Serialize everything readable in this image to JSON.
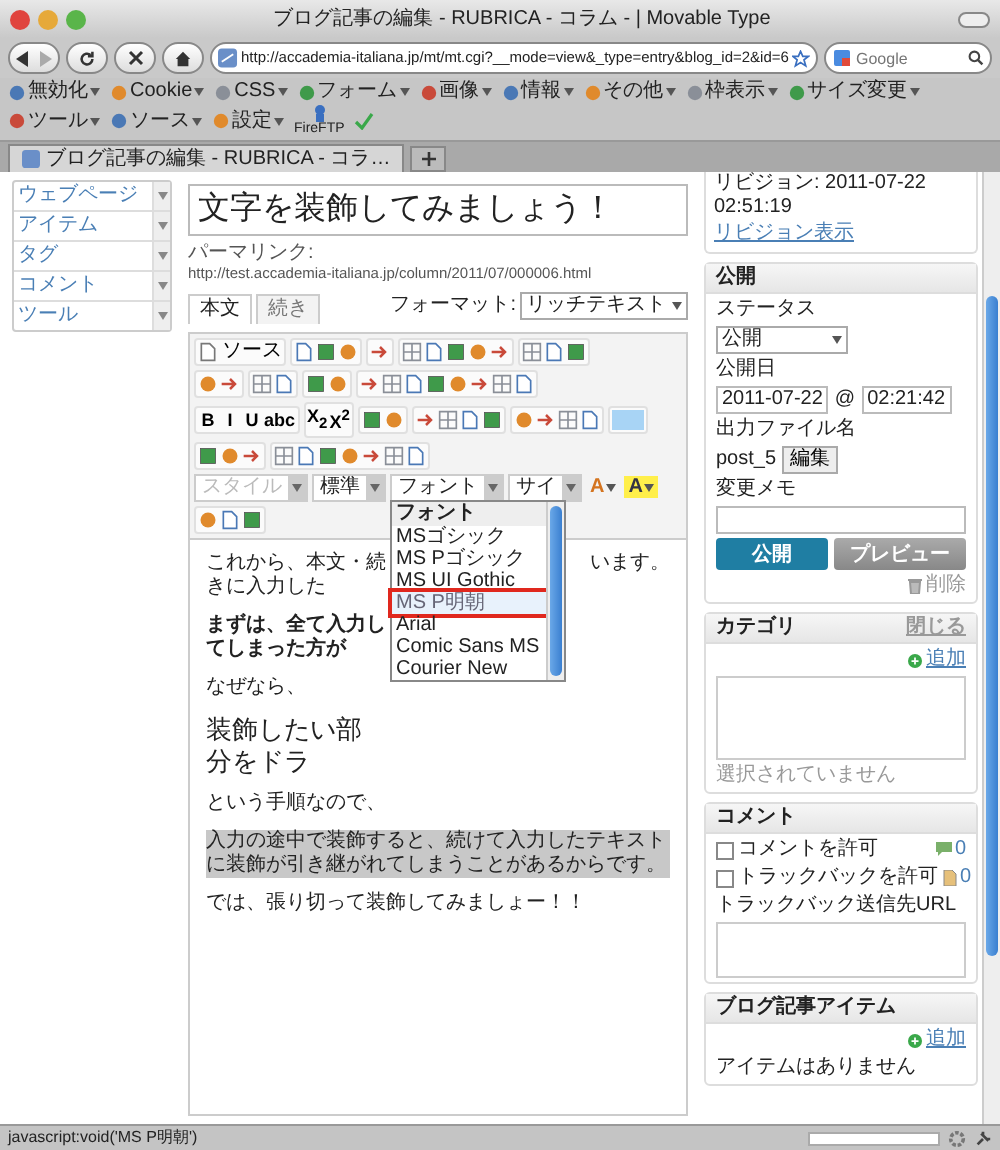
{
  "window": {
    "title": "ブログ記事の編集 - RUBRICA - コラム - | Movable Type"
  },
  "navigation": {
    "url": "http://accademia-italiana.jp/mt/mt.cgi?__mode=view&_type=entry&blog_id=2&id=6",
    "search_placeholder": "Google"
  },
  "bookmarks": [
    {
      "label": "無効化"
    },
    {
      "label": "Cookie"
    },
    {
      "label": "CSS"
    },
    {
      "label": "フォーム"
    },
    {
      "label": "画像"
    },
    {
      "label": "情報"
    },
    {
      "label": "その他"
    },
    {
      "label": "枠表示"
    },
    {
      "label": "サイズ変更"
    },
    {
      "label": "ツール"
    },
    {
      "label": "ソース"
    },
    {
      "label": "設定"
    }
  ],
  "fireftp": "FireFTP",
  "tabs": [
    {
      "title": "ブログ記事の編集 - RUBRICA - コラ…",
      "selected": true
    }
  ],
  "sidebar": {
    "items": [
      {
        "label": "ウェブページ"
      },
      {
        "label": "アイテム"
      },
      {
        "label": "タグ"
      },
      {
        "label": "コメント"
      },
      {
        "label": "ツール"
      }
    ]
  },
  "entry": {
    "title": "文字を装飾してみましょう！",
    "permalink_label": "パーマリンク:",
    "permalink": "http://test.accademia-italiana.jp/column/2011/07/000006.html",
    "editor_tabs": [
      {
        "label": "本文",
        "selected": true
      },
      {
        "label": "続き",
        "selected": false
      }
    ],
    "format_label": "フォーマット:",
    "format": "リッチテキスト",
    "toolbar_rows": [
      [
        [
          {
            "kind": "labeled",
            "label": "ソース"
          }
        ],
        [
          {
            "kind": "icon"
          },
          {
            "kind": "icon"
          },
          {
            "kind": "icon"
          }
        ],
        [
          {
            "kind": "icon"
          }
        ],
        [
          {
            "kind": "icon"
          },
          {
            "kind": "icon"
          },
          {
            "kind": "icon"
          },
          {
            "kind": "icon"
          },
          {
            "kind": "icon"
          }
        ],
        [
          {
            "kind": "icon"
          },
          {
            "kind": "icon"
          },
          {
            "kind": "icon"
          }
        ]
      ],
      [
        [
          {
            "kind": "icon"
          },
          {
            "kind": "icon"
          }
        ],
        [
          {
            "kind": "icon"
          },
          {
            "kind": "icon"
          }
        ],
        [
          {
            "kind": "icon"
          },
          {
            "kind": "icon"
          }
        ],
        [
          {
            "kind": "icon"
          },
          {
            "kind": "icon"
          },
          {
            "kind": "icon"
          },
          {
            "kind": "icon"
          },
          {
            "kind": "icon"
          },
          {
            "kind": "icon"
          },
          {
            "kind": "icon"
          },
          {
            "kind": "icon"
          }
        ]
      ],
      [
        [
          {
            "kind": "text",
            "label": "B"
          },
          {
            "kind": "text",
            "label": "I"
          },
          {
            "kind": "text",
            "label": "U"
          },
          {
            "kind": "text",
            "label": "abc"
          }
        ],
        [
          {
            "kind": "text",
            "label": "X$_{2}$"
          },
          {
            "kind": "text",
            "label": "X$^{2}$"
          }
        ],
        [
          {
            "kind": "icon"
          },
          {
            "kind": "icon"
          }
        ],
        [
          {
            "kind": "icon"
          },
          {
            "kind": "icon"
          },
          {
            "kind": "icon"
          },
          {
            "kind": "icon"
          }
        ],
        [
          {
            "kind": "icon"
          },
          {
            "kind": "icon"
          },
          {
            "kind": "icon"
          },
          {
            "kind": "icon"
          }
        ],
        [
          {
            "kind": "swatch"
          }
        ]
      ],
      [
        [
          {
            "kind": "icon"
          },
          {
            "kind": "icon"
          },
          {
            "kind": "icon"
          }
        ],
        [
          {
            "kind": "icon"
          },
          {
            "kind": "icon"
          },
          {
            "kind": "icon"
          },
          {
            "kind": "icon"
          },
          {
            "kind": "icon"
          },
          {
            "kind": "icon"
          },
          {
            "kind": "icon"
          }
        ]
      ]
    ],
    "selects": [
      {
        "label": "スタイル",
        "disabled": true
      },
      {
        "label": "標準",
        "disabled": false
      },
      {
        "label": "フォント",
        "disabled": false
      },
      {
        "label": "サイ",
        "disabled": false
      }
    ],
    "color_buttons": [
      "A",
      "A"
    ],
    "font_menu": {
      "header": "フォント",
      "items": [
        {
          "label": "MSゴシック",
          "selected": false
        },
        {
          "label": "MS Pゴシック",
          "selected": false
        },
        {
          "label": "MS UI Gothic",
          "selected": false
        },
        {
          "label": "MS P明朝",
          "selected": true
        },
        {
          "label": "Arial",
          "selected": false
        },
        {
          "label": "Comic Sans MS",
          "selected": false
        },
        {
          "label": "Courier New",
          "selected": false
        }
      ]
    },
    "paragraphs": [
      {
        "kind": "split",
        "left": "これから、本文・続きに入力した",
        "right": "います。"
      },
      {
        "kind": "bold",
        "text": "まずは、全て入力してしまった方が"
      },
      {
        "kind": "plain",
        "text": "なぜなら、"
      },
      {
        "kind": "heading",
        "text": "装飾したい部分をドラ"
      },
      {
        "kind": "plain",
        "text": "という手順なので、"
      },
      {
        "kind": "highlight",
        "text": "入力の途中で装飾すると、続けて入力したテキストに装飾が引き継がれてしまうことがあるからです。"
      },
      {
        "kind": "plain",
        "text": "では、張り切って装飾してみましょー！！"
      }
    ]
  },
  "revision": {
    "text": "リビジョン: 2011-07-22 02:51:19",
    "link": "リビジョン表示"
  },
  "publish": {
    "header": "公開",
    "status_label": "ステータス",
    "status": "公開",
    "date_label": "公開日",
    "date": "2011-07-22",
    "at": "@",
    "time": "02:21:42",
    "filename_label": "出力ファイル名",
    "filename": "post_5",
    "edit_button": "編集",
    "memo_label": "変更メモ",
    "publish_button": "公開",
    "preview_button": "プレビュー",
    "delete_link": "削除"
  },
  "category": {
    "header": "カテゴリ",
    "close_link": "閉じる",
    "add_link": "追加",
    "empty": "選択されていません"
  },
  "comments": {
    "header": "コメント",
    "options": [
      {
        "kind": "comment",
        "label": "コメントを許可",
        "checked": false,
        "count": "0"
      },
      {
        "kind": "trackback",
        "label": "トラックバックを許可",
        "checked": false,
        "count": "0"
      }
    ],
    "url_label": "トラックバック送信先URL"
  },
  "items_panel": {
    "header": "ブログ記事アイテム",
    "add_link": "追加",
    "empty": "アイテムはありません"
  },
  "status_bar": {
    "text": "javascript:void('MS P明朝')"
  }
}
